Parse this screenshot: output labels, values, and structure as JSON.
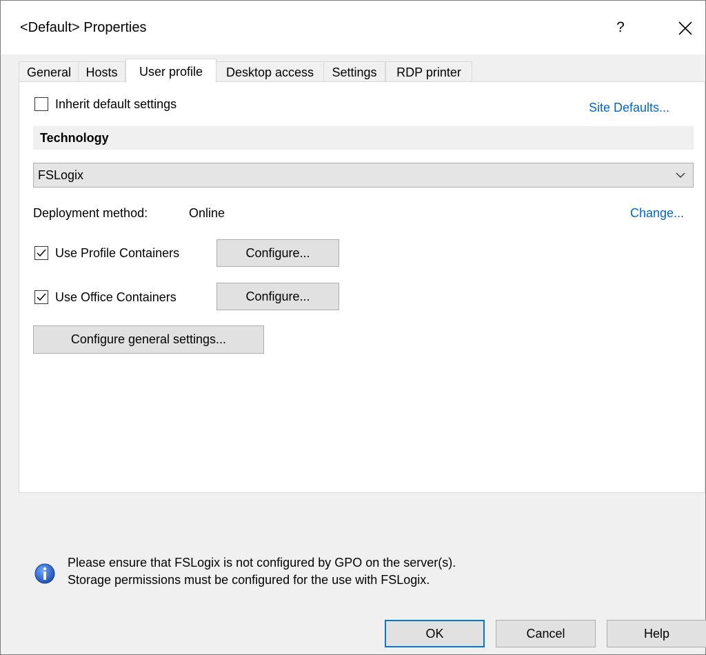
{
  "window": {
    "title": "<Default> Properties",
    "help_glyph": "?",
    "close_icon": "close-icon"
  },
  "tabs": [
    {
      "label": "General",
      "active": false
    },
    {
      "label": "Hosts",
      "active": false
    },
    {
      "label": "User profile",
      "active": true
    },
    {
      "label": "Desktop access",
      "active": false
    },
    {
      "label": "Settings",
      "active": false
    },
    {
      "label": "RDP printer",
      "active": false
    }
  ],
  "panel": {
    "inherit_label": "Inherit default settings",
    "inherit_checked": false,
    "site_defaults_link": "Site Defaults...",
    "technology_header": "Technology",
    "technology_value": "FSLogix",
    "deployment_label": "Deployment method:",
    "deployment_value": "Online",
    "change_link": "Change...",
    "profile_containers_label": "Use Profile Containers",
    "profile_containers_checked": true,
    "office_containers_label": "Use Office Containers",
    "office_containers_checked": true,
    "configure_label": "Configure...",
    "general_settings_label": "Configure general settings...",
    "info_line1": "Please ensure that FSLogix is not configured by GPO on the server(s).",
    "info_line2": "Storage permissions must be configured for the use with FSLogix."
  },
  "footer": {
    "ok": "OK",
    "cancel": "Cancel",
    "help": "Help"
  },
  "colors": {
    "link": "#0066cc",
    "default_button_border": "#0078d7",
    "info_icon": "#1e63c8"
  }
}
